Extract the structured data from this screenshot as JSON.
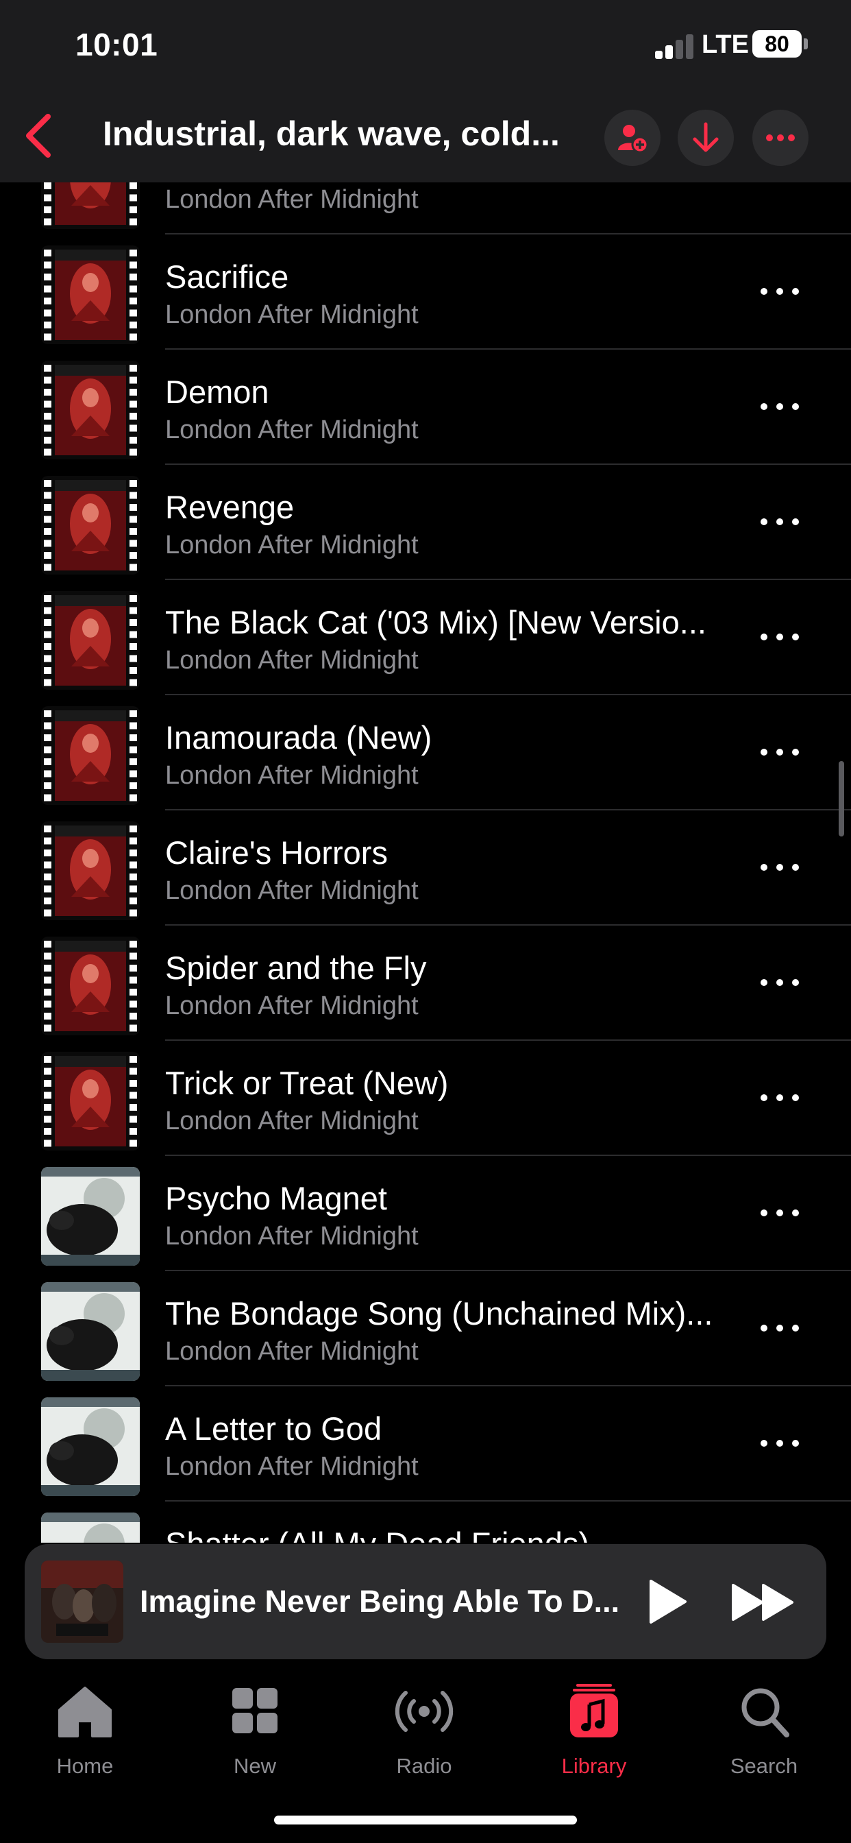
{
  "status_bar": {
    "time": "10:01",
    "network": "LTE",
    "battery": "80"
  },
  "header": {
    "title": "Industrial, dark wave, cold...",
    "colors": {
      "accent": "#fa2d48"
    }
  },
  "songs": [
    {
      "title": "",
      "artist": "London After Midnight",
      "art": "red-film"
    },
    {
      "title": "Sacrifice",
      "artist": "London After Midnight",
      "art": "red-film"
    },
    {
      "title": "Demon",
      "artist": "London After Midnight",
      "art": "red-film"
    },
    {
      "title": "Revenge",
      "artist": "London After Midnight",
      "art": "red-film"
    },
    {
      "title": "The Black Cat ('03 Mix) [New Versio...",
      "artist": "London After Midnight",
      "art": "red-film"
    },
    {
      "title": "Inamourada (New)",
      "artist": "London After Midnight",
      "art": "red-film"
    },
    {
      "title": "Claire's Horrors",
      "artist": "London After Midnight",
      "art": "red-film"
    },
    {
      "title": "Spider and the Fly",
      "artist": "London After Midnight",
      "art": "red-film"
    },
    {
      "title": "Trick or Treat (New)",
      "artist": "London After Midnight",
      "art": "red-film"
    },
    {
      "title": "Psycho Magnet",
      "artist": "London After Midnight",
      "art": "rat"
    },
    {
      "title": "The Bondage Song (Unchained Mix)...",
      "artist": "London After Midnight",
      "art": "rat"
    },
    {
      "title": "A Letter to God",
      "artist": "London After Midnight",
      "art": "rat"
    },
    {
      "title": "Shatter (All My Dead Friends)",
      "artist": "",
      "art": "rat"
    }
  ],
  "mini_player": {
    "title": "Imagine Never Being Able To D..."
  },
  "tabs": [
    {
      "label": "Home",
      "icon": "house-icon"
    },
    {
      "label": "New",
      "icon": "grid-icon"
    },
    {
      "label": "Radio",
      "icon": "radio-waves-icon"
    },
    {
      "label": "Library",
      "icon": "music-note-icon",
      "active": true
    },
    {
      "label": "Search",
      "icon": "search-icon"
    }
  ]
}
